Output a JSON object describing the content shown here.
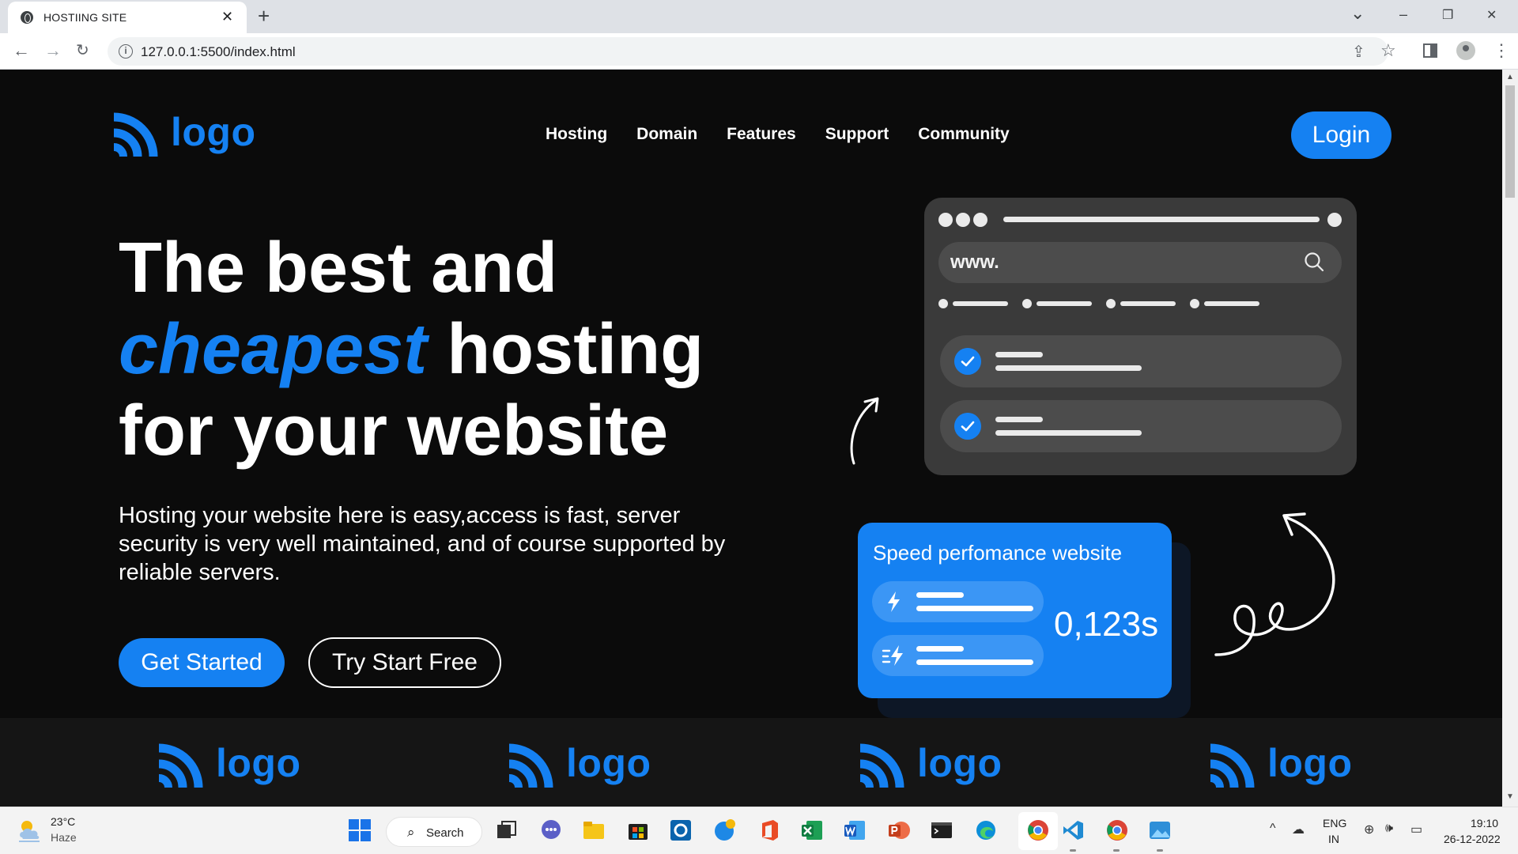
{
  "browser": {
    "tab_title": "HOSTIING SITE",
    "tab_close": "✕",
    "new_tab": "+",
    "url": "127.0.0.1:5500/index.html",
    "window_controls": {
      "minimize": "–",
      "maximize": "❐",
      "close": "✕",
      "tab_list": "⌄"
    }
  },
  "site": {
    "logo_text": "logo",
    "nav": [
      "Hosting",
      "Domain",
      "Features",
      "Support",
      "Community"
    ],
    "login_label": "Login",
    "hero": {
      "title_line1": "The best and",
      "title_accent": "cheapest",
      "title_line2_rest": " hosting",
      "title_line3": "for your website",
      "description": "Hosting your website here is easy,access is fast, server security is very well maintained, and of course supported by reliable servers.",
      "primary_cta": "Get Started",
      "secondary_cta": "Try Start Free"
    },
    "mock_browser": {
      "url_text": "www."
    },
    "speed_card": {
      "title": "Speed perfomance website",
      "value": "0,123s"
    },
    "partner_logos": [
      "logo",
      "logo",
      "logo",
      "logo"
    ]
  },
  "colors": {
    "accent": "#1581f2",
    "page_bg": "#0b0b0b",
    "card_bg": "#3a3a3a",
    "strip_bg": "#151515"
  },
  "taskbar": {
    "weather_temp": "23°C",
    "weather_desc": "Haze",
    "search_label": "Search",
    "lang_line1": "ENG",
    "lang_line2": "IN",
    "time": "19:10",
    "date": "26-12-2022",
    "apps": [
      "start-icon",
      "task-view-icon",
      "chat-icon",
      "file-explorer-icon",
      "store-icon",
      "outlook-icon",
      "edge-beta-icon",
      "office-icon",
      "excel-icon",
      "word-icon",
      "powerpoint-icon",
      "terminal-icon",
      "edge-icon",
      "chrome-icon",
      "vscode-icon",
      "chrome-icon",
      "photos-icon"
    ]
  }
}
